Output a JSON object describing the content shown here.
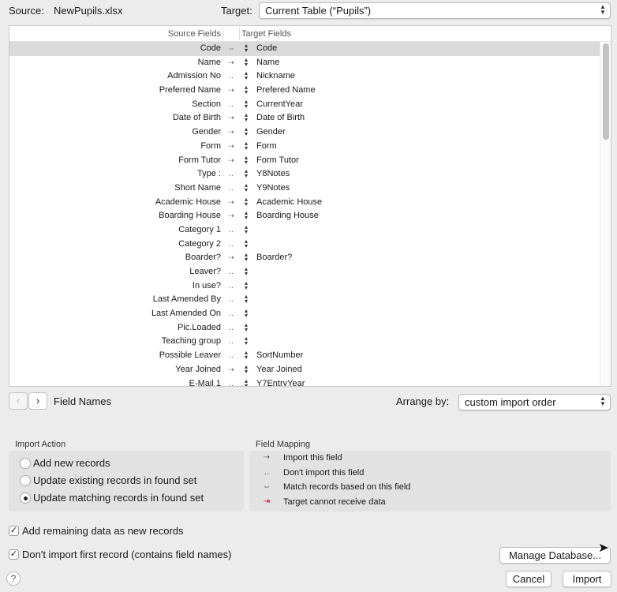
{
  "header": {
    "source_label": "Source:",
    "source_value": "NewPupils.xlsx",
    "target_label": "Target:",
    "target_value": "Current Table (“Pupils”)"
  },
  "table": {
    "col_source": "Source Fields",
    "col_target": "Target Fields",
    "rows": [
      {
        "src": "Code",
        "icon": "⇔",
        "tgt": "Code",
        "selected": true
      },
      {
        "src": "Name",
        "icon": "⇢",
        "tgt": "Name"
      },
      {
        "src": "Admission No",
        "icon": "‥",
        "tgt": "Nickname"
      },
      {
        "src": "Preferred Name",
        "icon": "⇢",
        "tgt": "Prefered Name"
      },
      {
        "src": "Section",
        "icon": "‥",
        "tgt": "CurrentYear"
      },
      {
        "src": "Date of Birth",
        "icon": "⇢",
        "tgt": "Date of Birth"
      },
      {
        "src": "Gender",
        "icon": "⇢",
        "tgt": "Gender"
      },
      {
        "src": "Form",
        "icon": "⇢",
        "tgt": "Form"
      },
      {
        "src": "Form Tutor",
        "icon": "⇢",
        "tgt": "Form Tutor"
      },
      {
        "src": "Type :",
        "icon": "‥",
        "tgt": "Y8Notes"
      },
      {
        "src": "Short Name",
        "icon": "‥",
        "tgt": "Y9Notes"
      },
      {
        "src": "Academic House",
        "icon": "⇢",
        "tgt": "Academic House"
      },
      {
        "src": "Boarding House",
        "icon": "⇢",
        "tgt": "Boarding House"
      },
      {
        "src": "Category 1",
        "icon": "‥",
        "tgt": ""
      },
      {
        "src": "Category 2",
        "icon": "‥",
        "tgt": ""
      },
      {
        "src": "Boarder?",
        "icon": "⇢",
        "tgt": "Boarder?"
      },
      {
        "src": "Leaver?",
        "icon": "‥",
        "tgt": ""
      },
      {
        "src": "In use?",
        "icon": "‥",
        "tgt": ""
      },
      {
        "src": "Last Amended By",
        "icon": "‥",
        "tgt": ""
      },
      {
        "src": "Last Amended On",
        "icon": "‥",
        "tgt": ""
      },
      {
        "src": "Pic.Loaded",
        "icon": "‥",
        "tgt": ""
      },
      {
        "src": "Teaching group",
        "icon": "‥",
        "tgt": ""
      },
      {
        "src": "Possible Leaver",
        "icon": "‥",
        "tgt": "SortNumber"
      },
      {
        "src": "Year Joined",
        "icon": "⇢",
        "tgt": "Year Joined"
      },
      {
        "src": "E-Mail 1",
        "icon": "‥",
        "tgt": "Y7EntryYear"
      }
    ]
  },
  "nav": {
    "prev_icon": "chevron-left-icon",
    "next_icon": "chevron-right-icon",
    "label": "Field Names",
    "arrange_label": "Arrange by:",
    "arrange_value": "custom import order"
  },
  "import_action": {
    "title": "Import Action",
    "options": [
      {
        "label": "Add new records",
        "selected": false
      },
      {
        "label": "Update existing records in found set",
        "selected": false
      },
      {
        "label": "Update matching records in found set",
        "selected": true
      }
    ]
  },
  "field_mapping": {
    "title": "Field Mapping",
    "items": [
      {
        "icon": "⇢",
        "label": "Import this field"
      },
      {
        "icon": "‥",
        "label": "Don't import this field"
      },
      {
        "icon": "⇔",
        "label": "Match records based on this field"
      },
      {
        "icon": "⇥",
        "label": "Target cannot receive data"
      }
    ]
  },
  "options": {
    "add_remaining": "Add remaining data as new records",
    "add_remaining_checked": true,
    "dont_import_first": "Don't import first record (contains field names)",
    "dont_import_first_checked": true
  },
  "buttons": {
    "manage_database": "Manage Database...",
    "cancel": "Cancel",
    "import": "Import",
    "help": "?"
  },
  "colors": {
    "window_bg": "#ececec",
    "selected_row": "#dadada",
    "target_red": "#d0021b"
  }
}
